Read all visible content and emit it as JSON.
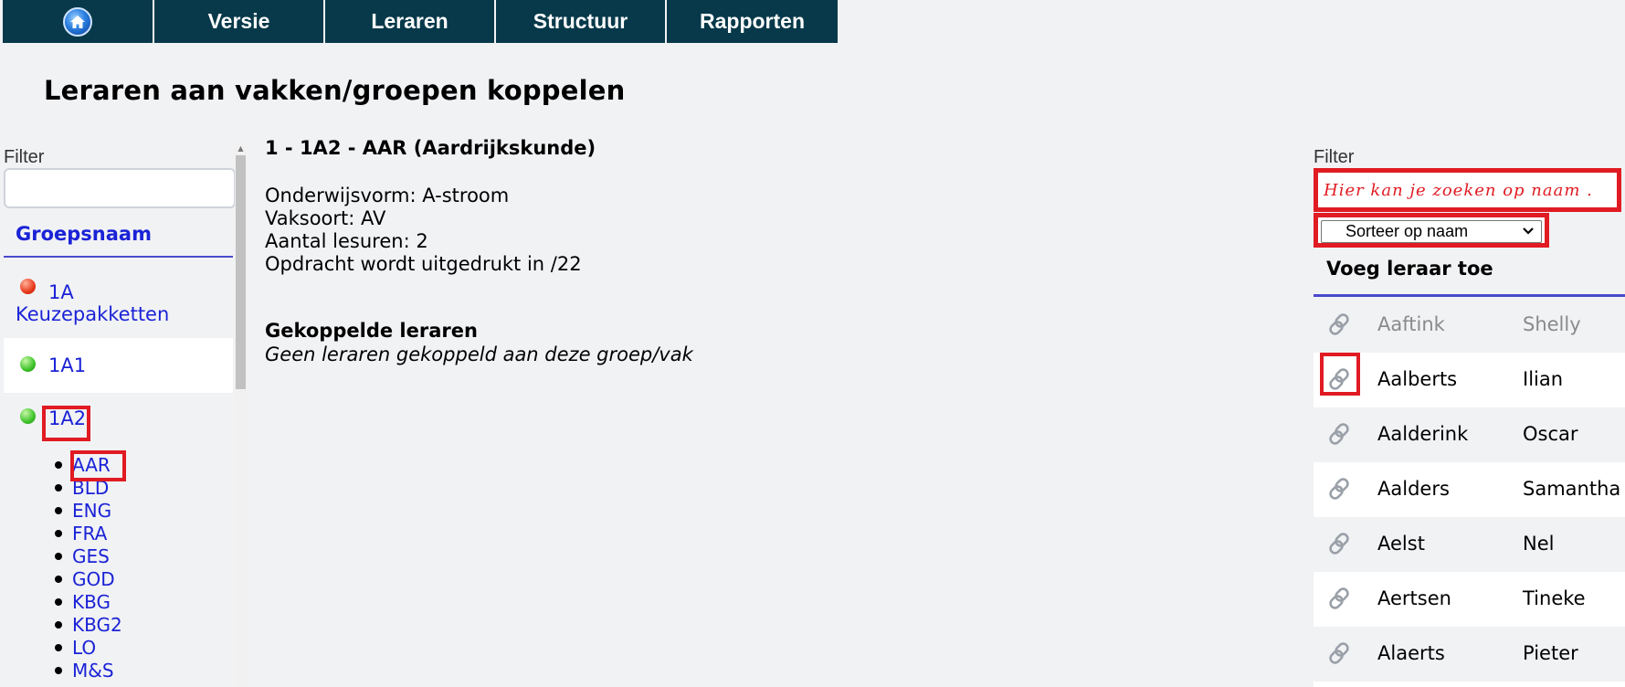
{
  "nav": {
    "items": [
      "Versie",
      "Leraren",
      "Structuur",
      "Rapporten"
    ]
  },
  "page_title": "Leraren aan vakken/groepen koppelen",
  "left": {
    "filter_label": "Filter",
    "filter_value": "",
    "column_header": "Groepsnaam",
    "groups": [
      {
        "label_line1": "1A",
        "label_line2": "Keuzepakketten",
        "status": "red"
      },
      {
        "label": "1A1",
        "status": "green"
      },
      {
        "label": "1A2",
        "status": "green"
      }
    ],
    "subjects": [
      "AAR",
      "BLD",
      "ENG",
      "FRA",
      "GES",
      "GOD",
      "KBG",
      "KBG2",
      "LO",
      "M&S"
    ]
  },
  "detail": {
    "title": "1 - 1A2 - AAR (Aardrijkskunde)",
    "onderwijsvorm": "Onderwijsvorm: A-stroom",
    "vaksoort": "Vaksoort: AV",
    "lesuren": "Aantal lesuren: 2",
    "opdracht": "Opdracht wordt uitgedrukt in /22",
    "linked_title": "Gekoppelde leraren",
    "linked_empty": "Geen leraren gekoppeld aan deze groep/vak"
  },
  "right": {
    "filter_label": "Filter",
    "search_annotation": "Hier kan je zoeken op naam .",
    "sort_selected": "Sorteer op naam",
    "header": "Voeg leraar toe",
    "teachers": [
      {
        "last": "Aaftink",
        "first": "Shelly"
      },
      {
        "last": "Aalberts",
        "first": "Ilian"
      },
      {
        "last": "Aalderink",
        "first": "Oscar"
      },
      {
        "last": "Aalders",
        "first": "Samantha"
      },
      {
        "last": "Aelst",
        "first": "Nel"
      },
      {
        "last": "Aertsen",
        "first": "Tineke"
      },
      {
        "last": "Alaerts",
        "first": "Pieter"
      }
    ]
  },
  "colors": {
    "nav_bg": "#07394a",
    "link_blue": "#1a23d6",
    "highlight_red": "#e01b22",
    "page_bg": "#f1f2f4"
  }
}
